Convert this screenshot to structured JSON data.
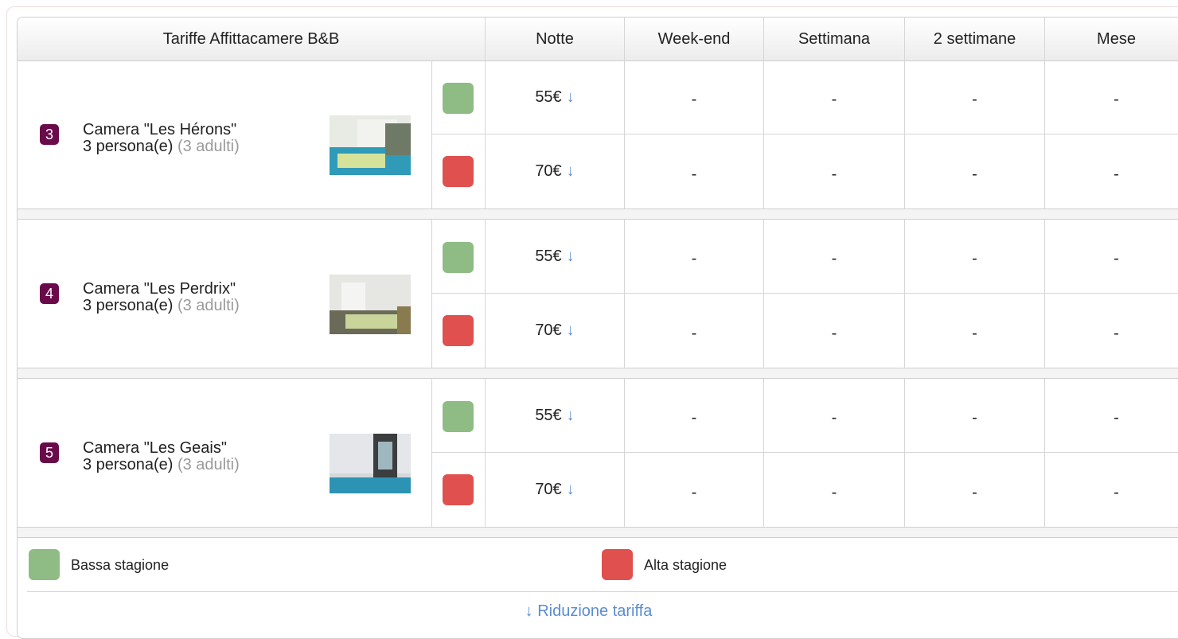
{
  "header": {
    "title": "Tariffe Affittacamere B&B",
    "columns": [
      "Notte",
      "Week-end",
      "Settimana",
      "2 settimane",
      "Mese"
    ]
  },
  "rooms": [
    {
      "number": "3",
      "name": "Camera \"Les Hérons\"",
      "capacity": "3 persona(e)",
      "adults": "(3 adulti)",
      "rates": [
        {
          "season": "low",
          "notte": "55€",
          "weekend": "-",
          "settimana": "-",
          "due_settimane": "-",
          "mese": "-"
        },
        {
          "season": "high",
          "notte": "70€",
          "weekend": "-",
          "settimana": "-",
          "due_settimane": "-",
          "mese": "-"
        }
      ]
    },
    {
      "number": "4",
      "name": "Camera \"Les Perdrix\"",
      "capacity": "3 persona(e)",
      "adults": "(3 adulti)",
      "rates": [
        {
          "season": "low",
          "notte": "55€",
          "weekend": "-",
          "settimana": "-",
          "due_settimane": "-",
          "mese": "-"
        },
        {
          "season": "high",
          "notte": "70€",
          "weekend": "-",
          "settimana": "-",
          "due_settimane": "-",
          "mese": "-"
        }
      ]
    },
    {
      "number": "5",
      "name": "Camera \"Les Geais\"",
      "capacity": "3 persona(e)",
      "adults": "(3 adulti)",
      "rates": [
        {
          "season": "low",
          "notte": "55€",
          "weekend": "-",
          "settimana": "-",
          "due_settimane": "-",
          "mese": "-"
        },
        {
          "season": "high",
          "notte": "70€",
          "weekend": "-",
          "settimana": "-",
          "due_settimane": "-",
          "mese": "-"
        }
      ]
    }
  ],
  "arrow": "↓",
  "legend": {
    "low_label": "Bassa stagione",
    "high_label": "Alta stagione",
    "reduction_link": "↓ Riduzione tariffa"
  },
  "colors": {
    "low_season": "#8fbc84",
    "high_season": "#e0504f",
    "badge": "#6a0a4a",
    "link": "#5b8dd0"
  }
}
